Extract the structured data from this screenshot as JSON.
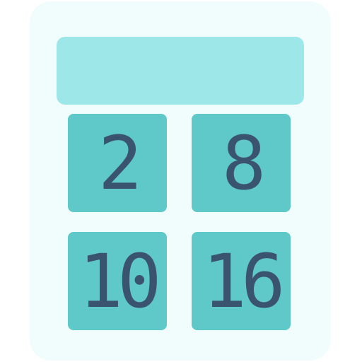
{
  "calculator": {
    "display": "",
    "keys": [
      {
        "label": "2"
      },
      {
        "label": "8"
      },
      {
        "label": "10"
      },
      {
        "label": "16"
      }
    ]
  },
  "colors": {
    "body": "#f1fcfc",
    "screen": "#9ee7e9",
    "key": "#5fc8c8",
    "digit": "#3a5470"
  }
}
